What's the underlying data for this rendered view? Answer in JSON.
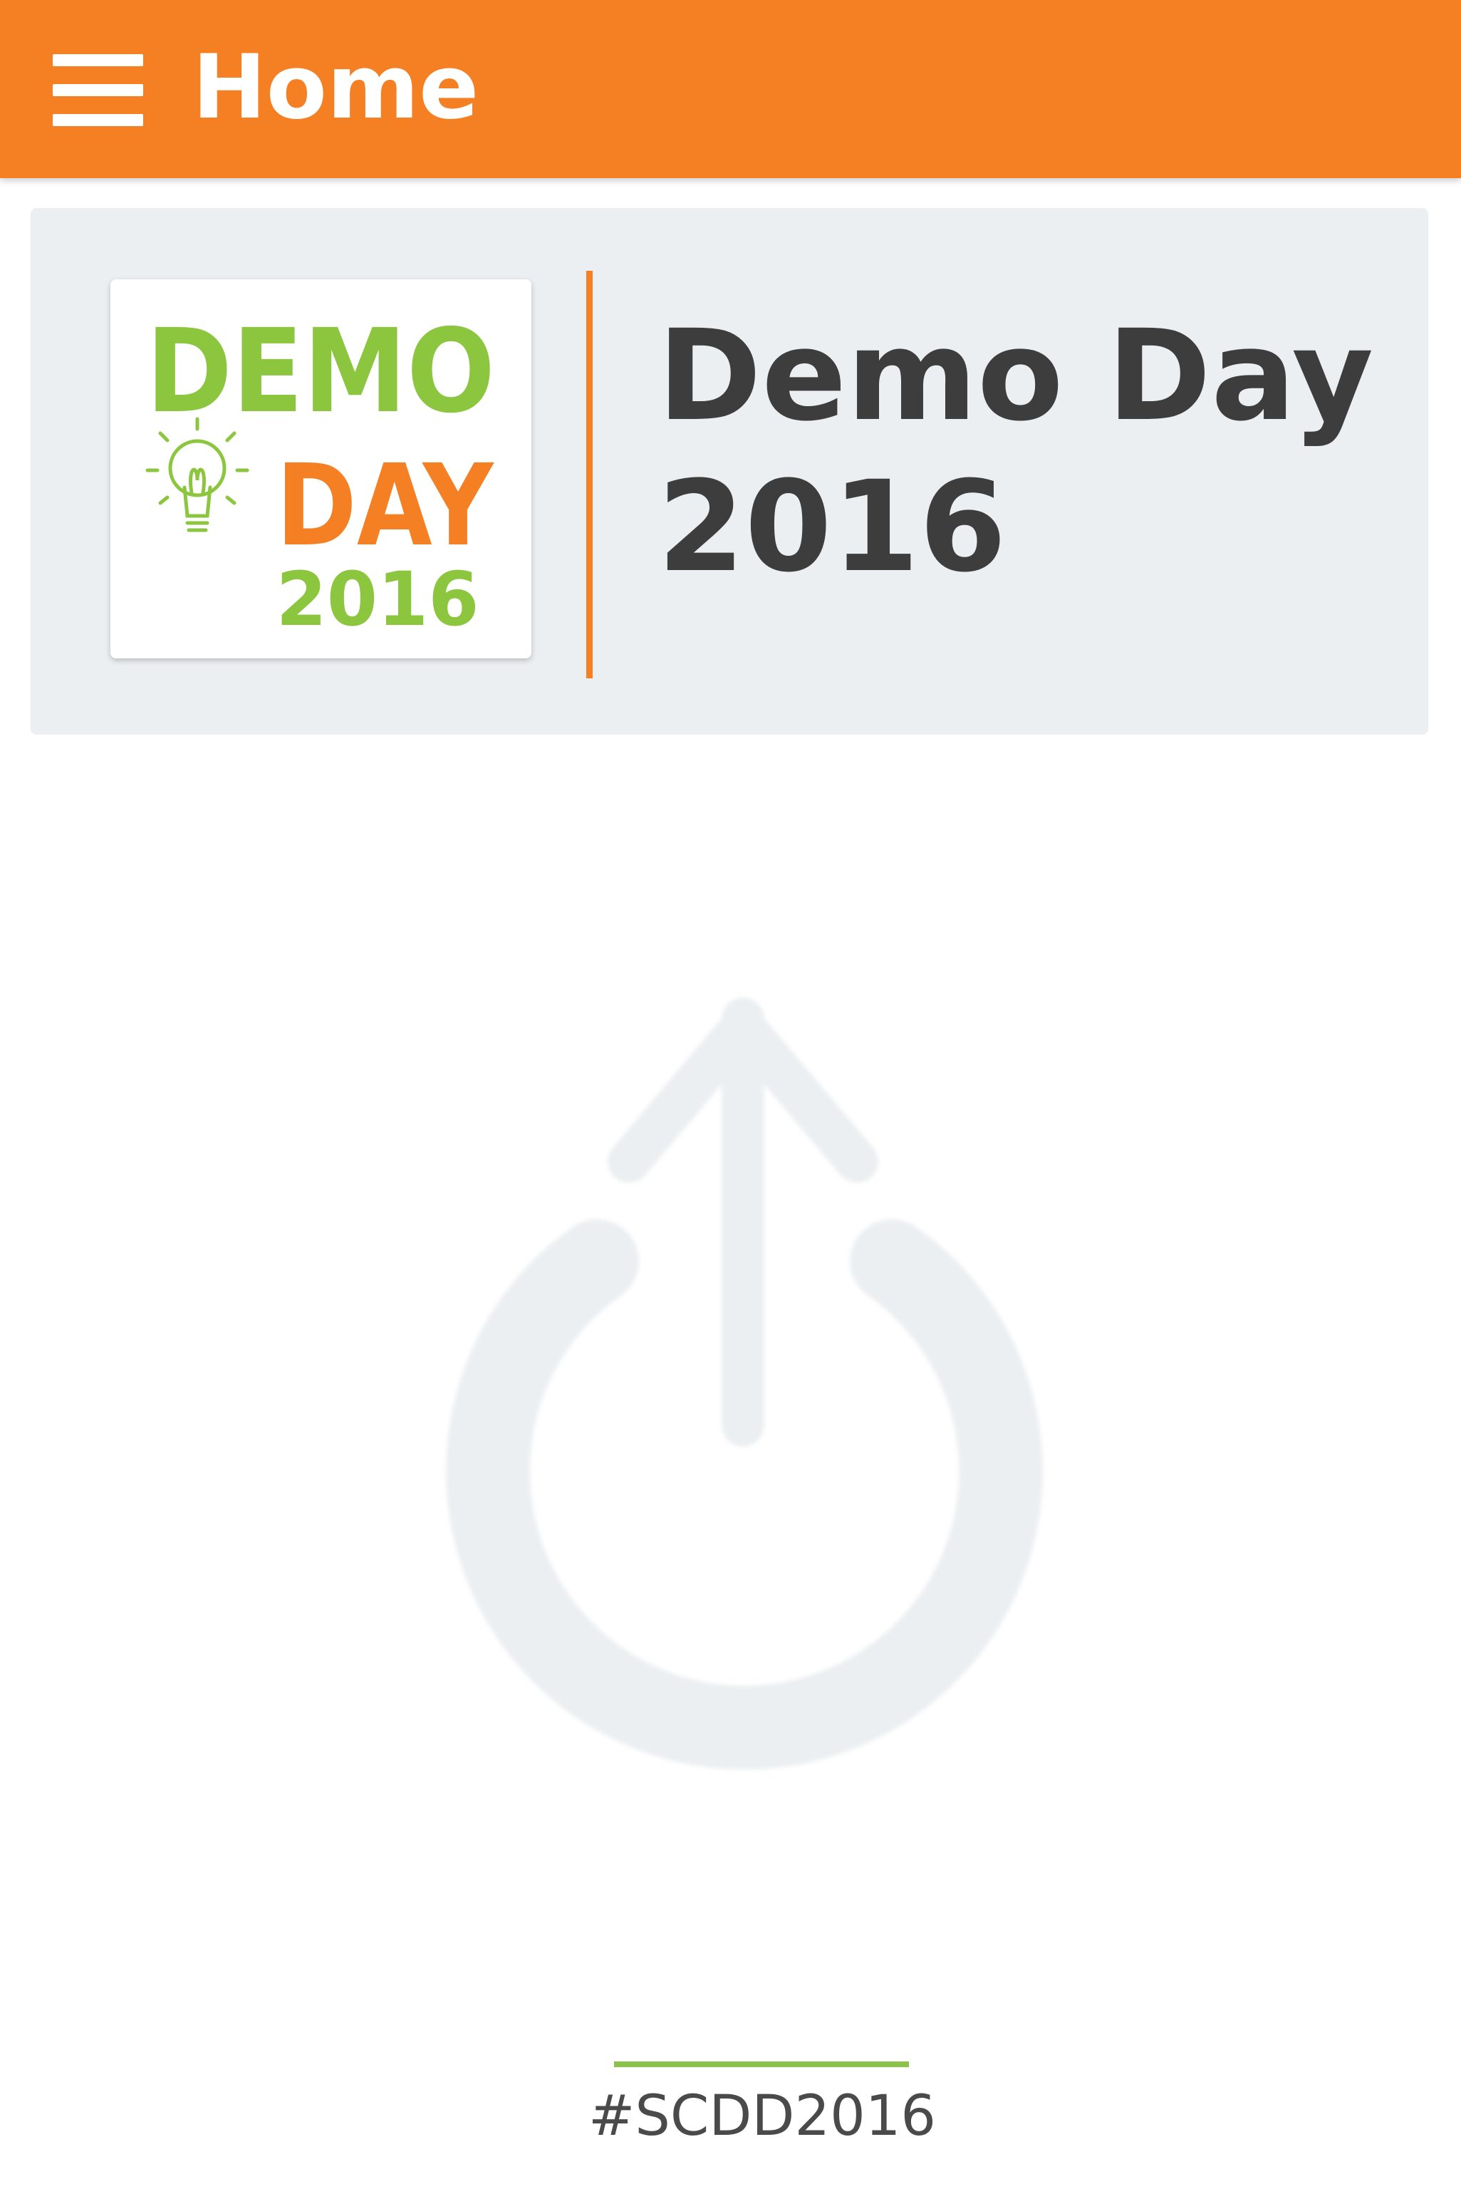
{
  "app_bar": {
    "title": "Home",
    "menu_icon": "hamburger-menu-icon",
    "color": "#f58024"
  },
  "event": {
    "title": "Demo Day 2016",
    "logo": {
      "line1": "DEMO",
      "line2": "DAY",
      "line3": "2016",
      "icon": "lightbulb-icon",
      "colors": {
        "green": "#8cc63f",
        "orange": "#f58024"
      }
    },
    "card_color": "#eceff1"
  },
  "center_graphic": {
    "icon": "power-arrow-icon",
    "color": "#eceff1"
  },
  "footer": {
    "hashtag": "#SCDD2016",
    "rule_color": "#8bc34a"
  }
}
